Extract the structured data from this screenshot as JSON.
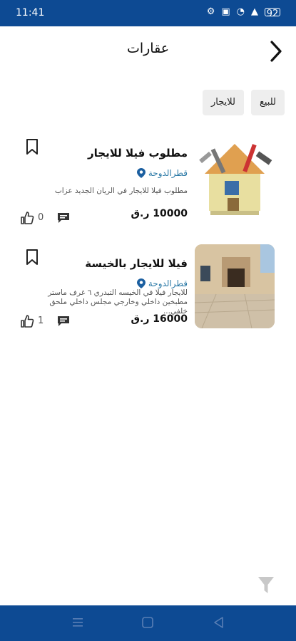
{
  "status_bar": {
    "time": "11:41",
    "battery": "92"
  },
  "header": {
    "title": "عقارات"
  },
  "filters": {
    "tabs": [
      "للبيع",
      "للايجار"
    ]
  },
  "listings": [
    {
      "title": "مطلوب فيلا للايجار",
      "location": "قطرالدوحة",
      "description": "مطلوب فيلا للايجار في الريان الجديد عزاب",
      "price": "10000 ر.ق",
      "likes": "0"
    },
    {
      "title": "فيلا للايجار بالخيسة",
      "location": "قطرالدوحة",
      "description": "للايجار فيلا في الخيسه التبدري ٦ غرف ماستر مطبخين داخلي وخارجي مجلس داخلي ملحق خلفي...",
      "price": "16000 ر.ق",
      "likes": "1"
    }
  ],
  "colors": {
    "brand": "#0d4a93",
    "location": "#2c7aa7",
    "tab_bg": "#eeeeee"
  },
  "icons": [
    "back-chevron-icon",
    "bookmark-icon",
    "like-icon",
    "comment-icon",
    "location-pin-icon",
    "filter-icon",
    "menu-icon",
    "home-icon",
    "back-triangle-icon"
  ]
}
